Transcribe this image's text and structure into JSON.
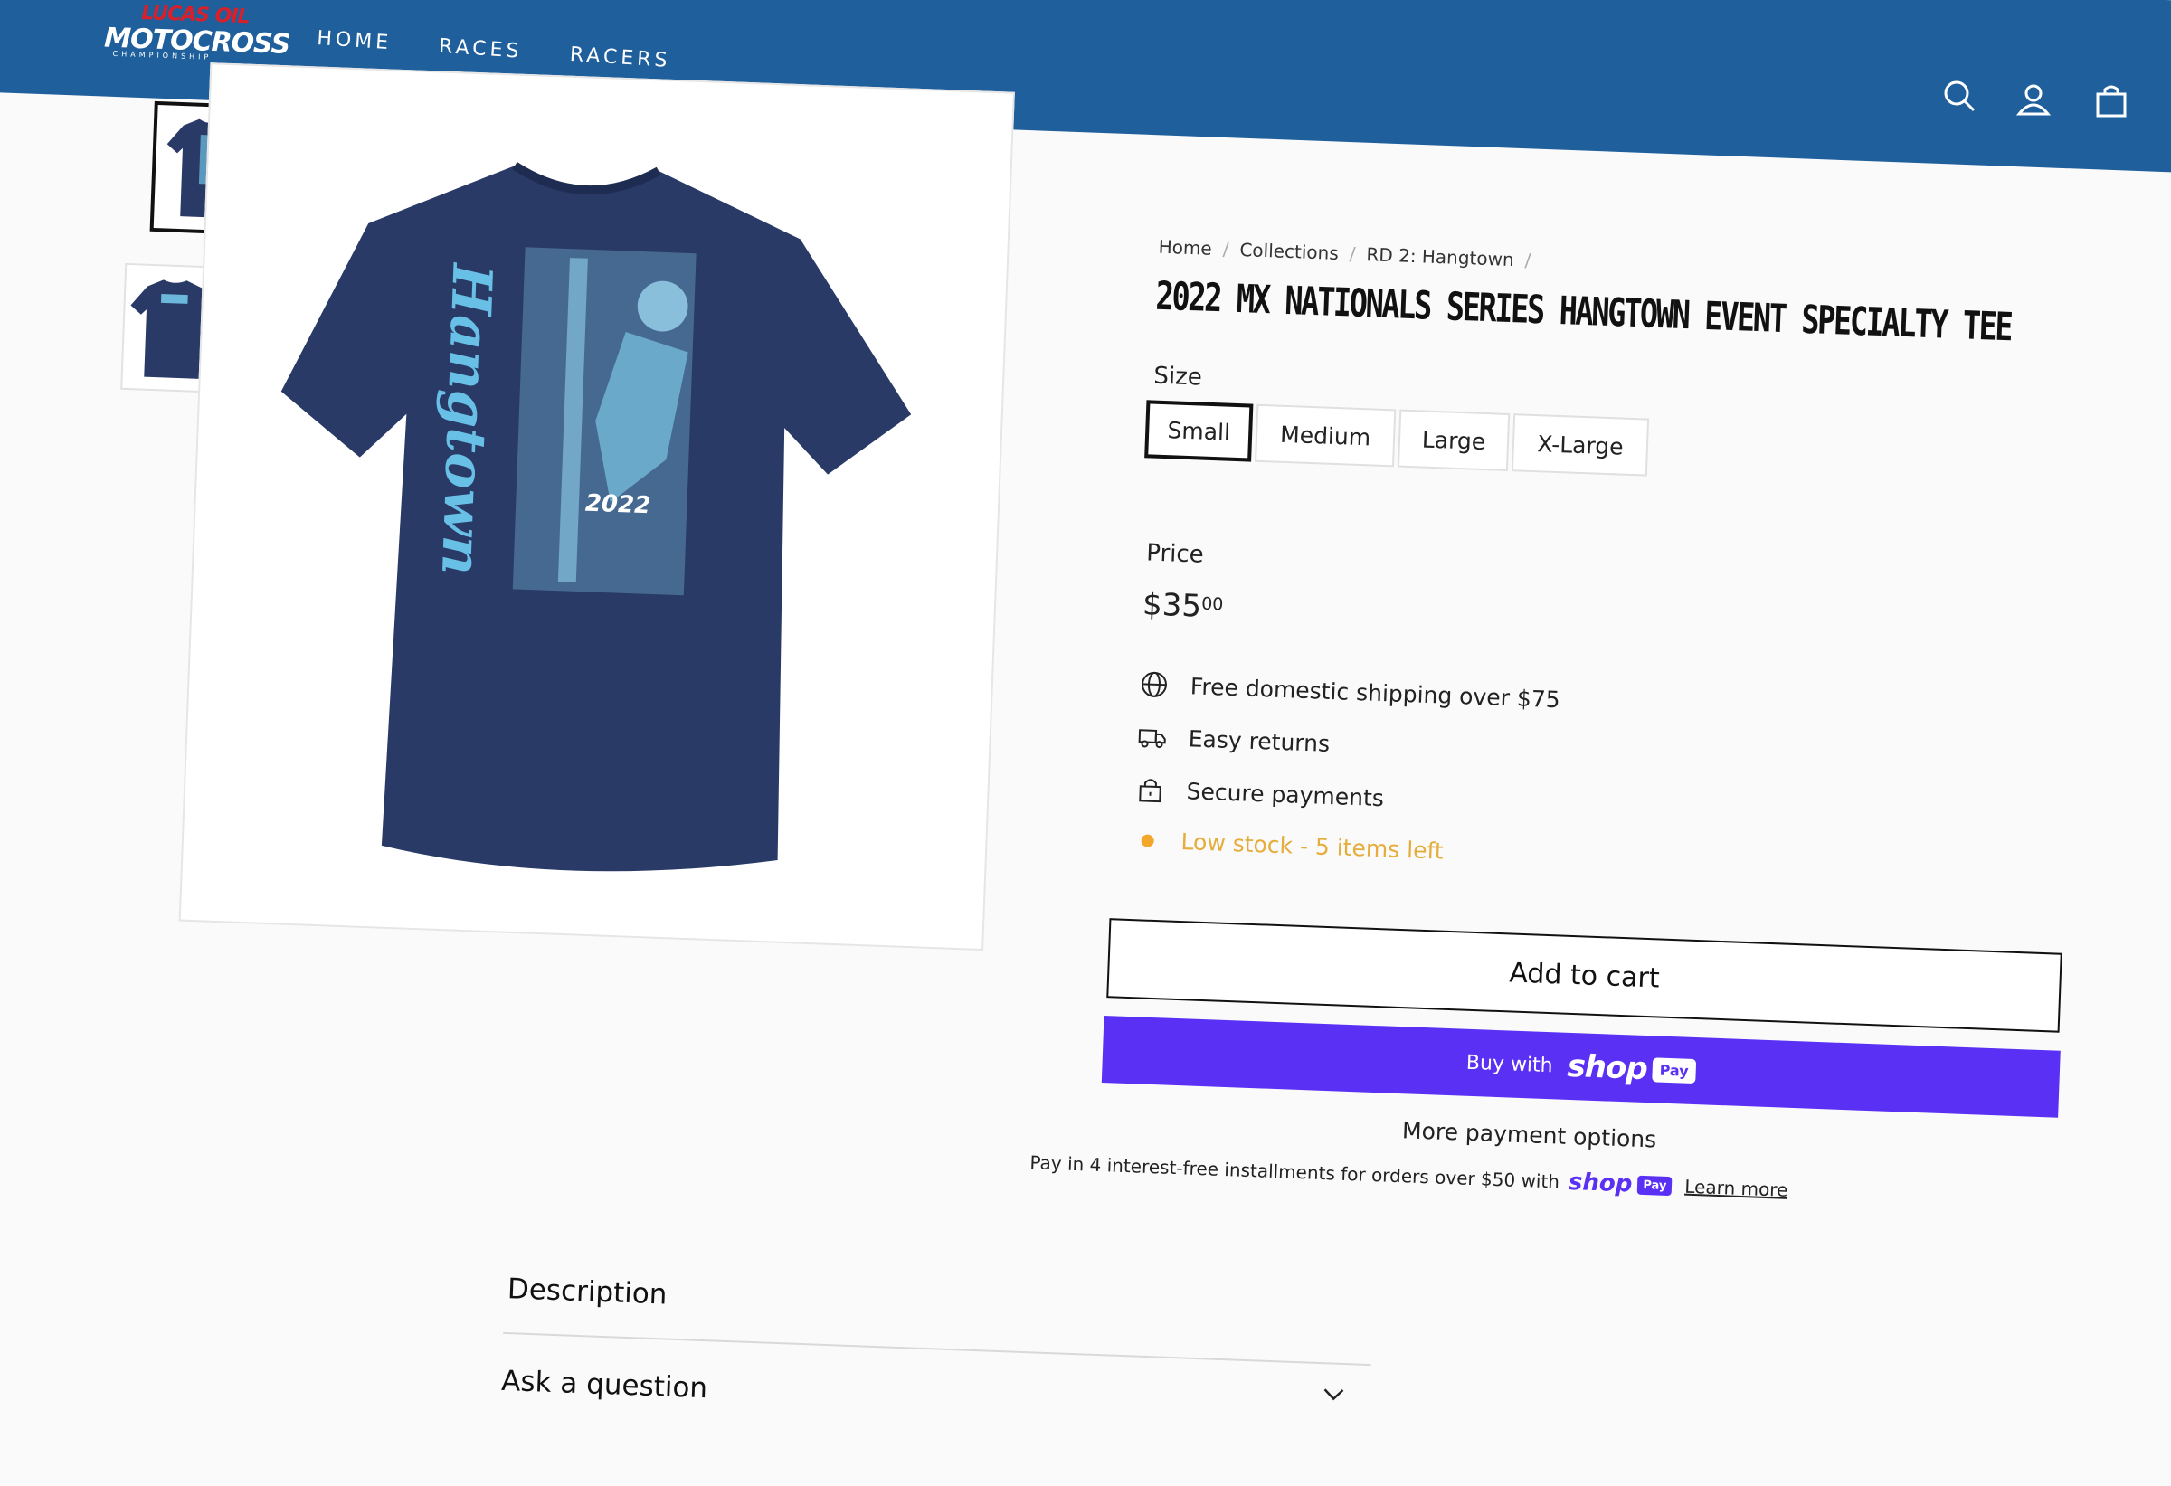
{
  "header": {
    "logo": {
      "line1": "LUCAS OIL",
      "line2": "MOTOCROSS",
      "line3": "CHAMPIONSHIP"
    },
    "nav": [
      "HOME",
      "RACES",
      "RACERS"
    ],
    "icons": [
      "search-icon",
      "account-icon",
      "cart-icon"
    ],
    "color": "#1f5f9c"
  },
  "gallery": {
    "thumbnails": [
      "front-view",
      "back-view"
    ],
    "main_print": {
      "word": "Hangtown",
      "year": "2022"
    },
    "shirt_color": "#2a3a66"
  },
  "breadcrumb": [
    "Home",
    "Collections",
    "RD 2: Hangtown"
  ],
  "product": {
    "title": "2022 MX NATIONALS SERIES HANGTOWN EVENT SPECIALTY TEE",
    "size_label": "Size",
    "sizes": [
      "Small",
      "Medium",
      "Large",
      "X-Large"
    ],
    "selected_size": "Small",
    "price_label": "Price",
    "price_main": "$35",
    "price_cents": "00"
  },
  "features": [
    {
      "icon": "globe-icon",
      "text": "Free domestic shipping over $75"
    },
    {
      "icon": "truck-icon",
      "text": "Easy returns"
    },
    {
      "icon": "lock-icon",
      "text": "Secure payments"
    },
    {
      "icon": "stock-dot-icon",
      "text": "Low stock - 5 items left"
    }
  ],
  "buttons": {
    "add_to_cart": "Add to cart",
    "buy_with": "Buy with",
    "shop": "shop",
    "pay": "Pay",
    "more_options": "More payment options"
  },
  "installments": {
    "text": "Pay in 4 interest-free installments for orders over $50 with",
    "shop": "shop",
    "pay": "Pay",
    "learn_more": "Learn more"
  },
  "accordion": [
    "Description",
    "Ask a question"
  ],
  "colors": {
    "shop_pay": "#5a31f4",
    "low_stock": "#e5ad3b"
  }
}
